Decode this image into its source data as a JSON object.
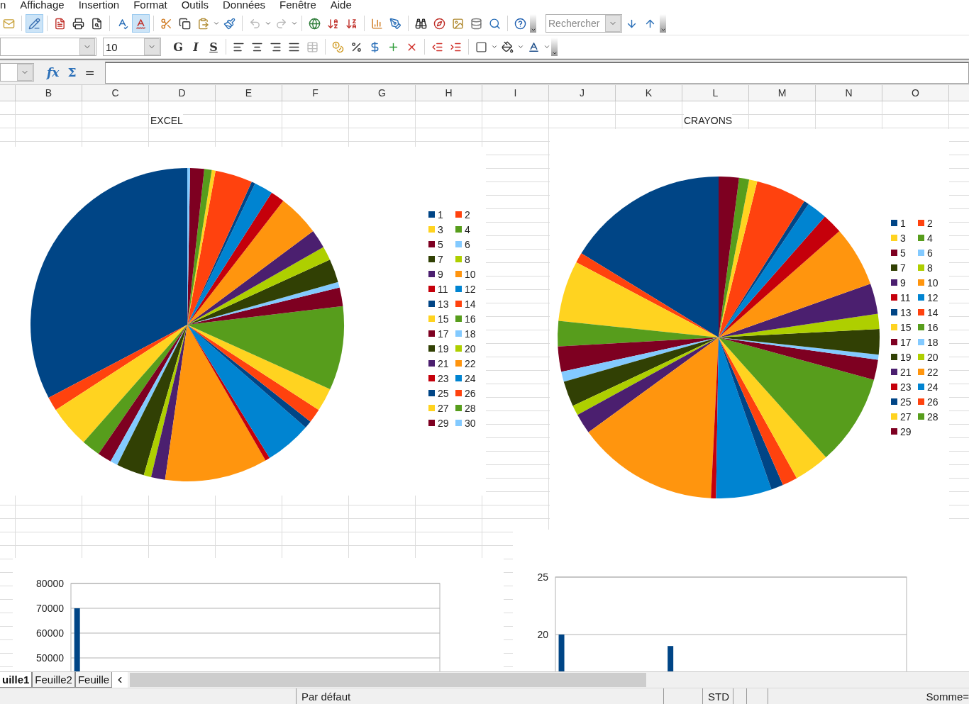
{
  "menu_bar": [
    "n",
    "Affichage",
    "Insertion",
    "Format",
    "Outils",
    "Données",
    "Fenêtre",
    "Aide"
  ],
  "standard_toolbar": {
    "edit_mode_pressed": true,
    "autospell_pressed": true,
    "undo_disabled": true,
    "redo_disabled": true,
    "search_placeholder": "Rechercher"
  },
  "formatting_toolbar": {
    "font_size": "10",
    "style_buttons": [
      "G",
      "I",
      "S"
    ]
  },
  "formula_bar": {
    "function_wizard": "fx",
    "sum": "Σ",
    "equals": "="
  },
  "columns": [
    "B",
    "C",
    "D",
    "E",
    "F",
    "G",
    "H",
    "I",
    "J",
    "K",
    "L",
    "M",
    "N",
    "O"
  ],
  "pie_charts": [
    {
      "heading": "EXCEL",
      "legend": [
        {
          "label": "1",
          "color": "#004586"
        },
        {
          "label": "2",
          "color": "#ff420e"
        },
        {
          "label": "3",
          "color": "#ffd320"
        },
        {
          "label": "4",
          "color": "#579d1c"
        },
        {
          "label": "5",
          "color": "#7e0021"
        },
        {
          "label": "6",
          "color": "#83caff"
        },
        {
          "label": "7",
          "color": "#314004"
        },
        {
          "label": "8",
          "color": "#aecf00"
        },
        {
          "label": "9",
          "color": "#4b1f6f"
        },
        {
          "label": "10",
          "color": "#ff950e"
        },
        {
          "label": "11",
          "color": "#c5000b"
        },
        {
          "label": "12",
          "color": "#0084d1"
        },
        {
          "label": "13",
          "color": "#004586"
        },
        {
          "label": "14",
          "color": "#ff420e"
        },
        {
          "label": "15",
          "color": "#ffd320"
        },
        {
          "label": "16",
          "color": "#579d1c"
        },
        {
          "label": "17",
          "color": "#7e0021"
        },
        {
          "label": "18",
          "color": "#83caff"
        },
        {
          "label": "19",
          "color": "#314004"
        },
        {
          "label": "20",
          "color": "#aecf00"
        },
        {
          "label": "21",
          "color": "#4b1f6f"
        },
        {
          "label": "22",
          "color": "#ff950e"
        },
        {
          "label": "23",
          "color": "#c5000b"
        },
        {
          "label": "24",
          "color": "#0084d1"
        },
        {
          "label": "25",
          "color": "#004586"
        },
        {
          "label": "26",
          "color": "#ff420e"
        },
        {
          "label": "27",
          "color": "#ffd320"
        },
        {
          "label": "28",
          "color": "#579d1c"
        },
        {
          "label": "29",
          "color": "#7e0021"
        },
        {
          "label": "30",
          "color": "#83caff"
        }
      ]
    },
    {
      "heading": "CRAYONS",
      "legend": [
        {
          "label": "1",
          "color": "#004586"
        },
        {
          "label": "2",
          "color": "#ff420e"
        },
        {
          "label": "3",
          "color": "#ffd320"
        },
        {
          "label": "4",
          "color": "#579d1c"
        },
        {
          "label": "5",
          "color": "#7e0021"
        },
        {
          "label": "6",
          "color": "#83caff"
        },
        {
          "label": "7",
          "color": "#314004"
        },
        {
          "label": "8",
          "color": "#aecf00"
        },
        {
          "label": "9",
          "color": "#4b1f6f"
        },
        {
          "label": "10",
          "color": "#ff950e"
        },
        {
          "label": "11",
          "color": "#c5000b"
        },
        {
          "label": "12",
          "color": "#0084d1"
        },
        {
          "label": "13",
          "color": "#004586"
        },
        {
          "label": "14",
          "color": "#ff420e"
        },
        {
          "label": "15",
          "color": "#ffd320"
        },
        {
          "label": "16",
          "color": "#579d1c"
        },
        {
          "label": "17",
          "color": "#7e0021"
        },
        {
          "label": "18",
          "color": "#83caff"
        },
        {
          "label": "19",
          "color": "#314004"
        },
        {
          "label": "20",
          "color": "#aecf00"
        },
        {
          "label": "21",
          "color": "#4b1f6f"
        },
        {
          "label": "22",
          "color": "#ff950e"
        },
        {
          "label": "23",
          "color": "#c5000b"
        },
        {
          "label": "24",
          "color": "#0084d1"
        },
        {
          "label": "25",
          "color": "#004586"
        },
        {
          "label": "26",
          "color": "#ff420e"
        },
        {
          "label": "27",
          "color": "#ffd320"
        },
        {
          "label": "28",
          "color": "#579d1c"
        },
        {
          "label": "29",
          "color": "#7e0021"
        }
      ]
    }
  ],
  "bar_charts": [
    {
      "chart_data": {
        "type": "bar",
        "grid": true,
        "ylim": [
          0,
          80000
        ],
        "yticks": [
          50000,
          60000,
          70000,
          80000
        ],
        "series": [
          {
            "color": "#004586",
            "values": [
              70000,
              null,
              null,
              null,
              null,
              null,
              null,
              null,
              null,
              null,
              null,
              null,
              null,
              null,
              null,
              null,
              null,
              null,
              null,
              null,
              null,
              null,
              null,
              null,
              null,
              null,
              null,
              null,
              null,
              null
            ]
          }
        ]
      }
    },
    {
      "chart_data": {
        "type": "bar",
        "grid": true,
        "ylim": [
          0,
          25
        ],
        "yticks": [
          20,
          25
        ],
        "series": [
          {
            "color": "#004586",
            "values": [
              20,
              null,
              null,
              null,
              null,
              null,
              null,
              null,
              null,
              19,
              null,
              null,
              null,
              null,
              null,
              null,
              null,
              null,
              null,
              null,
              null,
              null,
              null,
              null,
              null,
              null,
              null,
              null,
              null
            ]
          }
        ]
      }
    }
  ],
  "sheet_tabs": [
    {
      "label": "uille1",
      "selected": true
    },
    {
      "label": "Feuille2",
      "selected": false
    },
    {
      "label": "Feuille",
      "selected": false
    }
  ],
  "status_bar": {
    "page_style": "Par défaut",
    "selection_mode": "STD",
    "sum": "Somme="
  }
}
